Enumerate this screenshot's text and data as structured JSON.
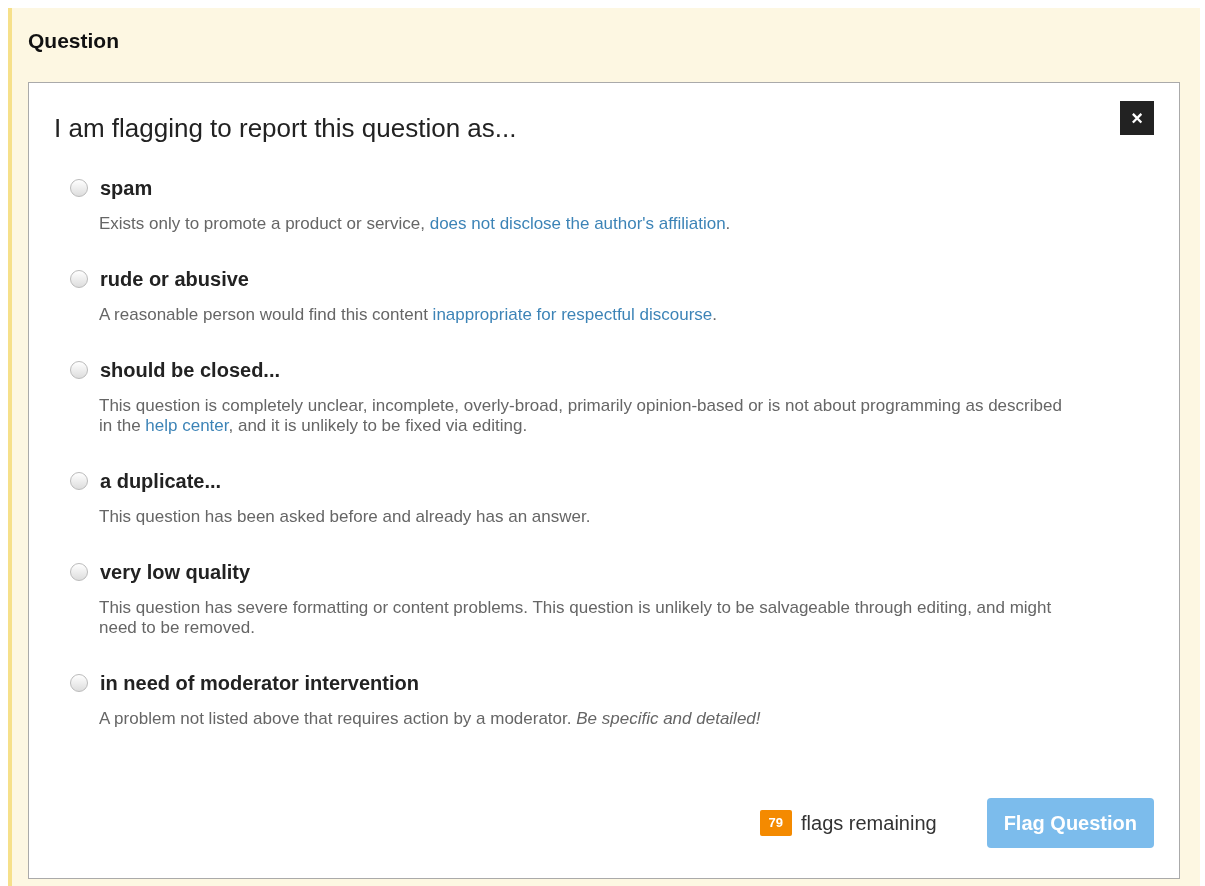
{
  "section": {
    "title": "Question"
  },
  "dialog": {
    "title": "I am flagging to report this question as...",
    "close": "×",
    "options": [
      {
        "label": "spam",
        "selected": false,
        "description": [
          {
            "kind": "plain",
            "text": "Exists only to promote a product or service, "
          },
          {
            "kind": "link",
            "text": "does not disclose the author's affiliation"
          },
          {
            "kind": "plain",
            "text": "."
          }
        ]
      },
      {
        "label": "rude or abusive",
        "selected": false,
        "description": [
          {
            "kind": "plain",
            "text": "A reasonable person would find this content "
          },
          {
            "kind": "link",
            "text": "inappropriate for respectful discourse"
          },
          {
            "kind": "plain",
            "text": "."
          }
        ]
      },
      {
        "label": "should be closed...",
        "selected": false,
        "description": [
          {
            "kind": "plain",
            "text": "This question is completely unclear, incomplete, overly-broad, primarily opinion-based or is not about programming as described in the "
          },
          {
            "kind": "link",
            "text": "help center"
          },
          {
            "kind": "plain",
            "text": ", and it is unlikely to be fixed via editing."
          }
        ]
      },
      {
        "label": "a duplicate...",
        "selected": false,
        "description": [
          {
            "kind": "plain",
            "text": "This question has been asked before and already has an answer."
          }
        ]
      },
      {
        "label": "very low quality",
        "selected": false,
        "description": [
          {
            "kind": "plain",
            "text": "This question has severe formatting or content problems. This question is unlikely to be salvageable through editing, and might need to be removed."
          }
        ]
      },
      {
        "label": "in need of moderator intervention",
        "selected": false,
        "description": [
          {
            "kind": "plain",
            "text": "A problem not listed above that requires action by a moderator. "
          },
          {
            "kind": "emphasis",
            "text": "Be specific and detailed!"
          }
        ]
      }
    ],
    "flags_count": "79",
    "flags_label": "flags remaining",
    "submit": {
      "label": "Flag Question",
      "disabled": true
    }
  }
}
